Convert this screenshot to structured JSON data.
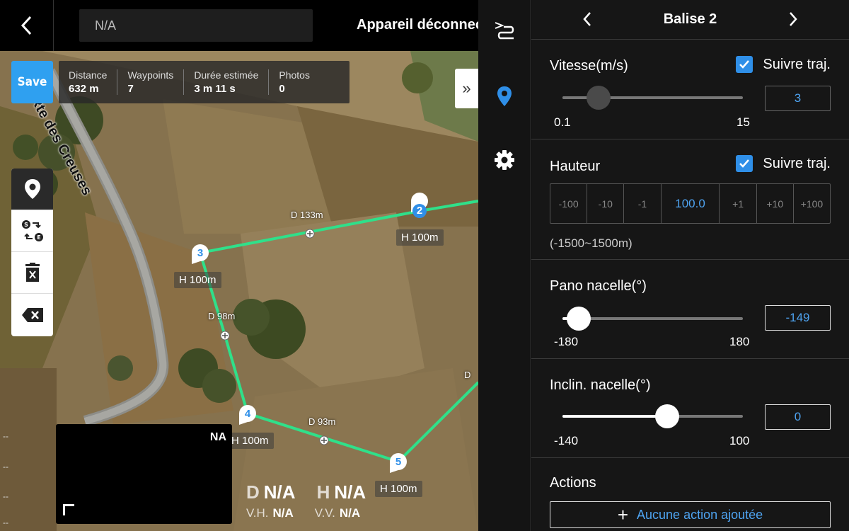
{
  "topbar": {
    "search_value": "N/A",
    "device_status": "Appareil déconnecté"
  },
  "mission": {
    "save_label": "Save",
    "stats": [
      {
        "label": "Distance",
        "value": "632 m"
      },
      {
        "label": "Waypoints",
        "value": "7"
      },
      {
        "label": "Durée estimée",
        "value": "3 m 11 s"
      },
      {
        "label": "Photos",
        "value": "0"
      }
    ],
    "expand_label": "»"
  },
  "map": {
    "road_name": "Rte des Creuses",
    "waypoints": [
      {
        "number": "2",
        "height_label": "H 100m"
      },
      {
        "number": "3",
        "height_label": "H 100m"
      },
      {
        "number": "4",
        "height_label": "H 100m"
      },
      {
        "number": "5",
        "height_label": "H 100m"
      }
    ],
    "distances": [
      "D 133m",
      "D 98m",
      "D 93m",
      "D"
    ],
    "edge_marks": [
      "--",
      "--",
      "--",
      "--"
    ]
  },
  "camera": {
    "status": "NA"
  },
  "telemetry": {
    "d_label": "D",
    "d_value": "N/A",
    "h_label": "H",
    "h_value": "N/A",
    "vh_label": "V.H.",
    "vh_value": "N/A",
    "vv_label": "V.V.",
    "vv_value": "N/A"
  },
  "panel": {
    "title": "Balise 2",
    "speed": {
      "title": "Vitesse(m/s)",
      "follow_label": "Suivre traj.",
      "follow_checked": true,
      "min": "0.1",
      "max": "15",
      "value": "3",
      "level": 0.2
    },
    "height": {
      "title": "Hauteur",
      "follow_label": "Suivre traj.",
      "follow_checked": true,
      "steps_minus": [
        "-100",
        "-10",
        "-1"
      ],
      "value": "100.0",
      "steps_plus": [
        "+1",
        "+10",
        "+100"
      ],
      "range": "(-1500~1500m)"
    },
    "gimbal_pan": {
      "title": "Pano nacelle(°)",
      "min": "-180",
      "max": "180",
      "value": "-149",
      "level": 0.09
    },
    "gimbal_tilt": {
      "title": "Inclin. nacelle(°)",
      "min": "-140",
      "max": "100",
      "value": "0",
      "level": 0.58
    },
    "actions": {
      "title": "Actions",
      "add_label": "Aucune action ajoutée"
    }
  },
  "colors": {
    "accent": "#2f8fe8",
    "route": "#2fe08a",
    "save": "#2fa0f0"
  }
}
